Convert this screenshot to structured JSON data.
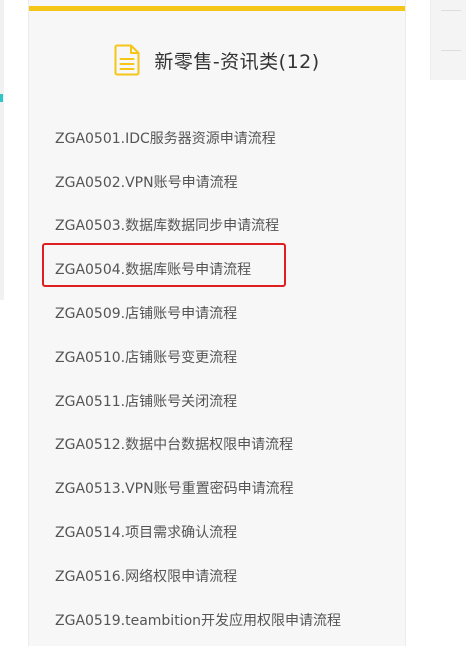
{
  "card": {
    "title": "新零售-资讯类(12)",
    "icon": "document-icon",
    "accent_color": "#f5c518",
    "icon_color": "#f5c518"
  },
  "items": [
    {
      "label": "ZGA0501.IDC服务器资源申请流程"
    },
    {
      "label": "ZGA0502.VPN账号申请流程"
    },
    {
      "label": "ZGA0503.数据库数据同步申请流程"
    },
    {
      "label": "ZGA0504.数据库账号申请流程",
      "highlighted": true
    },
    {
      "label": "ZGA0509.店铺账号申请流程"
    },
    {
      "label": "ZGA0510.店铺账号变更流程"
    },
    {
      "label": "ZGA0511.店铺账号关闭流程"
    },
    {
      "label": "ZGA0512.数据中台数据权限申请流程"
    },
    {
      "label": "ZGA0513.VPN账号重置密码申请流程"
    },
    {
      "label": "ZGA0514.项目需求确认流程"
    },
    {
      "label": "ZGA0516.网络权限申请流程"
    },
    {
      "label": "ZGA0519.teambition开发应用权限申请流程"
    }
  ],
  "highlight_color": "#e02020"
}
